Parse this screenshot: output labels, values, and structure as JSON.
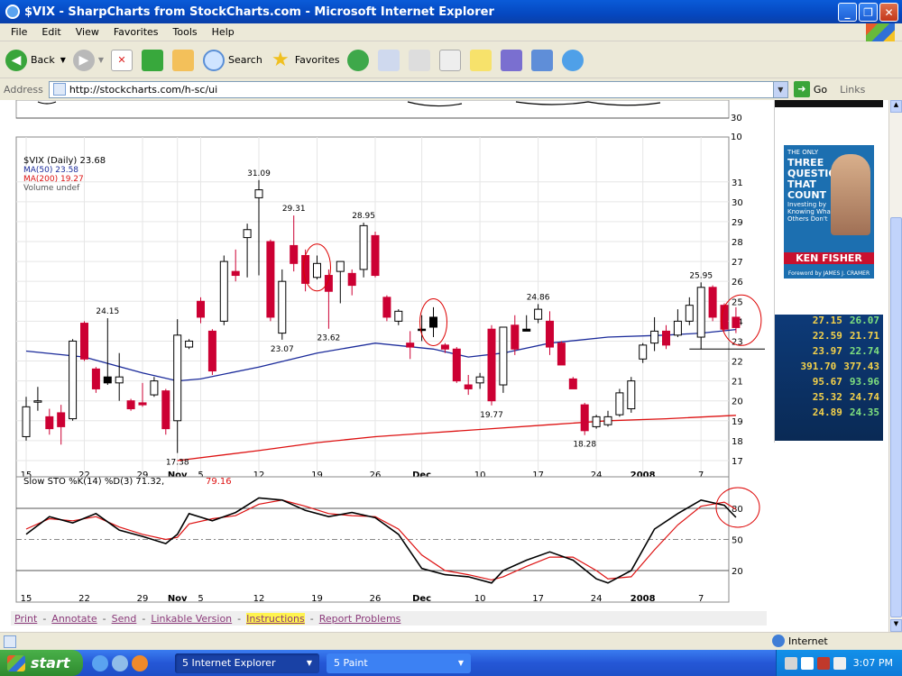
{
  "window": {
    "title": "$VIX - SharpCharts from StockCharts.com - Microsoft Internet Explorer",
    "btn_min": "_",
    "btn_max": "❐",
    "btn_close": "✕"
  },
  "menu": [
    "File",
    "Edit",
    "View",
    "Favorites",
    "Tools",
    "Help"
  ],
  "toolbar": {
    "back": "Back",
    "search": "Search",
    "favorites": "Favorites"
  },
  "address": {
    "label": "Address",
    "url": "http://stockcharts.com/h-sc/ui",
    "go": "Go",
    "links": "Links"
  },
  "ad": {
    "book_top": "THE ONLY",
    "book_title": "THREE QUESTIONS THAT COUNT",
    "book_sub": "Investing by Knowing What Others Don't",
    "author": "KEN FISHER",
    "foreword": "Foreword by JAMES J. CRAMER",
    "ticker_rows": [
      [
        "27.15",
        "26.07"
      ],
      [
        "22.59",
        "21.71"
      ],
      [
        "23.97",
        "22.74"
      ],
      [
        "391.70",
        "377.43"
      ],
      [
        "95.67",
        "93.96"
      ],
      [
        "25.32",
        "24.74"
      ],
      [
        "24.89",
        "24.35"
      ]
    ]
  },
  "chart_data": {
    "type": "candlestick",
    "legend": {
      "symbol": "$VIX (Daily) 23.68",
      "ma50": "MA(50) 23.58",
      "ma200": "MA(200) 19.27",
      "volume": "Volume undef"
    },
    "ylim": [
      16.5,
      32.8
    ],
    "y_ticks": [
      17,
      18,
      19,
      20,
      21,
      22,
      23,
      24,
      25,
      26,
      27,
      28,
      29,
      30,
      31
    ],
    "top_panel_ticks": [
      "30",
      "10"
    ],
    "x_ticks": [
      "15",
      "22",
      "29",
      "Nov",
      "5",
      "12",
      "19",
      "26",
      "Dec",
      "10",
      "17",
      "24",
      "2008",
      "7"
    ],
    "x_tick_days": [
      0,
      5,
      10,
      13,
      15,
      20,
      25,
      30,
      34,
      39,
      44,
      49,
      53,
      58
    ],
    "candles": [
      {
        "d": 0,
        "o": 18.2,
        "h": 20.2,
        "l": 18.0,
        "c": 19.7
      },
      {
        "d": 1,
        "o": 20.0,
        "h": 20.7,
        "l": 19.5,
        "c": 20.0
      },
      {
        "d": 2,
        "o": 19.2,
        "h": 19.6,
        "l": 18.3,
        "c": 18.6
      },
      {
        "d": 3,
        "o": 19.4,
        "h": 19.8,
        "l": 17.8,
        "c": 18.7
      },
      {
        "d": 4,
        "o": 19.1,
        "h": 23.1,
        "l": 19.0,
        "c": 23.0
      },
      {
        "d": 5,
        "o": 23.9,
        "h": 24.0,
        "l": 22.0,
        "c": 22.1
      },
      {
        "d": 6,
        "o": 21.6,
        "h": 21.7,
        "l": 20.4,
        "c": 20.6
      },
      {
        "d": 7,
        "o": 21.2,
        "h": 24.15,
        "l": 20.8,
        "c": 20.9
      },
      {
        "d": 8,
        "o": 20.9,
        "h": 22.4,
        "l": 20.0,
        "c": 21.2
      },
      {
        "d": 9,
        "o": 20.0,
        "h": 20.1,
        "l": 19.5,
        "c": 19.6
      },
      {
        "d": 10,
        "o": 19.9,
        "h": 20.9,
        "l": 19.7,
        "c": 19.8
      },
      {
        "d": 11,
        "o": 20.3,
        "h": 21.2,
        "l": 20.2,
        "c": 21.0
      },
      {
        "d": 12,
        "o": 20.5,
        "h": 20.6,
        "l": 18.3,
        "c": 18.6
      },
      {
        "d": 13,
        "o": 19.0,
        "h": 24.1,
        "l": 17.38,
        "c": 23.3
      },
      {
        "d": 14,
        "o": 23.0,
        "h": 23.1,
        "l": 22.6,
        "c": 22.7
      },
      {
        "d": 15,
        "o": 24.2,
        "h": 25.2,
        "l": 23.9,
        "c": 25.0
      },
      {
        "d": 16,
        "o": 23.5,
        "h": 23.6,
        "l": 21.3,
        "c": 21.5
      },
      {
        "d": 17,
        "o": 24.0,
        "h": 27.3,
        "l": 23.8,
        "c": 27.0
      },
      {
        "d": 18,
        "o": 26.5,
        "h": 27.6,
        "l": 26.0,
        "c": 26.3
      },
      {
        "d": 19,
        "o": 28.2,
        "h": 28.9,
        "l": 26.2,
        "c": 28.6
      },
      {
        "d": 20,
        "o": 30.2,
        "h": 31.09,
        "l": 26.3,
        "c": 30.6
      },
      {
        "d": 21,
        "o": 28.0,
        "h": 28.1,
        "l": 24.0,
        "c": 24.2
      },
      {
        "d": 22,
        "o": 23.4,
        "h": 26.6,
        "l": 23.07,
        "c": 26.0
      },
      {
        "d": 23,
        "o": 26.9,
        "h": 29.31,
        "l": 26.5,
        "c": 27.8
      },
      {
        "d": 24,
        "o": 27.3,
        "h": 27.6,
        "l": 25.5,
        "c": 25.9
      },
      {
        "d": 25,
        "o": 26.9,
        "h": 27.3,
        "l": 26.1,
        "c": 26.2
      },
      {
        "d": 26,
        "o": 26.3,
        "h": 26.6,
        "l": 23.62,
        "c": 25.5
      },
      {
        "d": 27,
        "o": 26.5,
        "h": 27.0,
        "l": 24.9,
        "c": 27.0
      },
      {
        "d": 28,
        "o": 26.4,
        "h": 26.6,
        "l": 25.3,
        "c": 25.8
      },
      {
        "d": 29,
        "o": 26.6,
        "h": 28.95,
        "l": 26.2,
        "c": 28.8
      },
      {
        "d": 30,
        "o": 28.3,
        "h": 28.5,
        "l": 26.2,
        "c": 26.3
      },
      {
        "d": 31,
        "o": 25.2,
        "h": 25.3,
        "l": 24.0,
        "c": 24.2
      },
      {
        "d": 32,
        "o": 24.5,
        "h": 24.6,
        "l": 23.8,
        "c": 24.0
      },
      {
        "d": 33,
        "o": 22.9,
        "h": 23.5,
        "l": 22.1,
        "c": 22.7
      },
      {
        "d": 34,
        "o": 23.6,
        "h": 24.3,
        "l": 23.0,
        "c": 23.6
      },
      {
        "d": 35,
        "o": 24.2,
        "h": 24.7,
        "l": 23.2,
        "c": 23.7
      },
      {
        "d": 36,
        "o": 22.8,
        "h": 22.9,
        "l": 22.4,
        "c": 22.6
      },
      {
        "d": 37,
        "o": 22.6,
        "h": 22.7,
        "l": 20.9,
        "c": 21.0
      },
      {
        "d": 38,
        "o": 20.8,
        "h": 21.3,
        "l": 20.3,
        "c": 20.6
      },
      {
        "d": 39,
        "o": 20.9,
        "h": 21.4,
        "l": 20.6,
        "c": 21.2
      },
      {
        "d": 40,
        "o": 23.6,
        "h": 23.8,
        "l": 19.77,
        "c": 20.0
      },
      {
        "d": 41,
        "o": 20.8,
        "h": 22.9,
        "l": 20.4,
        "c": 23.7
      },
      {
        "d": 42,
        "o": 23.8,
        "h": 24.3,
        "l": 22.3,
        "c": 22.6
      },
      {
        "d": 43,
        "o": 23.6,
        "h": 24.3,
        "l": 23.5,
        "c": 23.5
      },
      {
        "d": 44,
        "o": 24.1,
        "h": 24.86,
        "l": 23.9,
        "c": 24.6
      },
      {
        "d": 45,
        "o": 24.0,
        "h": 24.5,
        "l": 22.3,
        "c": 22.7
      },
      {
        "d": 46,
        "o": 22.9,
        "h": 23.0,
        "l": 21.9,
        "c": 21.8
      },
      {
        "d": 47,
        "o": 21.1,
        "h": 21.2,
        "l": 20.6,
        "c": 20.6
      },
      {
        "d": 48,
        "o": 19.8,
        "h": 19.9,
        "l": 18.28,
        "c": 18.5
      },
      {
        "d": 49,
        "o": 18.7,
        "h": 19.3,
        "l": 18.6,
        "c": 19.2
      },
      {
        "d": 50,
        "o": 18.8,
        "h": 19.5,
        "l": 18.7,
        "c": 19.2
      },
      {
        "d": 51,
        "o": 19.3,
        "h": 20.6,
        "l": 19.2,
        "c": 20.4
      },
      {
        "d": 52,
        "o": 19.6,
        "h": 21.2,
        "l": 19.4,
        "c": 21.0
      },
      {
        "d": 53,
        "o": 22.1,
        "h": 22.9,
        "l": 21.9,
        "c": 22.8
      },
      {
        "d": 54,
        "o": 22.9,
        "h": 24.2,
        "l": 22.5,
        "c": 23.5
      },
      {
        "d": 55,
        "o": 23.5,
        "h": 23.8,
        "l": 22.6,
        "c": 22.8
      },
      {
        "d": 56,
        "o": 23.3,
        "h": 24.6,
        "l": 23.2,
        "c": 24.0
      },
      {
        "d": 57,
        "o": 24.0,
        "h": 25.2,
        "l": 23.8,
        "c": 24.8
      },
      {
        "d": 58,
        "o": 23.2,
        "h": 25.95,
        "l": 22.6,
        "c": 25.7
      },
      {
        "d": 59,
        "o": 25.7,
        "h": 25.8,
        "l": 24.0,
        "c": 24.2
      },
      {
        "d": 60,
        "o": 24.8,
        "h": 24.9,
        "l": 23.5,
        "c": 23.6
      },
      {
        "d": 61,
        "o": 24.2,
        "h": 24.7,
        "l": 23.4,
        "c": 23.68
      }
    ],
    "bullish": [
      0,
      1,
      4,
      8,
      11,
      13,
      14,
      17,
      19,
      20,
      22,
      25,
      27,
      29,
      32,
      39,
      41,
      44,
      49,
      50,
      51,
      52,
      53,
      54,
      56,
      57,
      58
    ],
    "filled_up": [
      7,
      34,
      35,
      43
    ],
    "value_labels": [
      {
        "d": 7,
        "text": "24.15",
        "v": 24.15,
        "pos": "above"
      },
      {
        "d": 13,
        "text": "17.38",
        "v": 17.38,
        "pos": "below"
      },
      {
        "d": 20,
        "text": "31.09",
        "v": 31.09,
        "pos": "above"
      },
      {
        "d": 22,
        "text": "23.07",
        "v": 23.07,
        "pos": "below"
      },
      {
        "d": 23,
        "text": "29.31",
        "v": 29.31,
        "pos": "above"
      },
      {
        "d": 26,
        "text": "23.62",
        "v": 23.62,
        "pos": "below"
      },
      {
        "d": 29,
        "text": "28.95",
        "v": 28.95,
        "pos": "above"
      },
      {
        "d": 40,
        "text": "19.77",
        "v": 19.77,
        "pos": "below"
      },
      {
        "d": 44,
        "text": "24.86",
        "v": 24.86,
        "pos": "above"
      },
      {
        "d": 48,
        "text": "18.28",
        "v": 18.28,
        "pos": "below"
      },
      {
        "d": 58,
        "text": "25.95",
        "v": 25.95,
        "pos": "above"
      }
    ],
    "ma50": [
      [
        0,
        22.5
      ],
      [
        5,
        22.2
      ],
      [
        10,
        21.4
      ],
      [
        13,
        21.0
      ],
      [
        15,
        21.1
      ],
      [
        20,
        21.7
      ],
      [
        25,
        22.4
      ],
      [
        30,
        22.9
      ],
      [
        35,
        22.6
      ],
      [
        38,
        22.2
      ],
      [
        41,
        22.4
      ],
      [
        45,
        22.9
      ],
      [
        50,
        23.2
      ],
      [
        55,
        23.3
      ],
      [
        58,
        23.4
      ],
      [
        61,
        23.58
      ]
    ],
    "ma200": [
      [
        13,
        17.0
      ],
      [
        20,
        17.5
      ],
      [
        25,
        17.9
      ],
      [
        30,
        18.2
      ],
      [
        35,
        18.4
      ],
      [
        40,
        18.6
      ],
      [
        45,
        18.8
      ],
      [
        50,
        19.0
      ],
      [
        55,
        19.1
      ],
      [
        61,
        19.27
      ]
    ],
    "annotation_circles_days": [
      25,
      35,
      61
    ],
    "ref_line_value": 22.6,
    "stoch": {
      "label": "Slow STO %K(14) %D(3) 71.32,",
      "d_label": "79.16",
      "ylim": [
        0,
        100
      ],
      "y_ticks": [
        20,
        50,
        80
      ],
      "k": [
        [
          0,
          55
        ],
        [
          2,
          72
        ],
        [
          4,
          66
        ],
        [
          6,
          75
        ],
        [
          8,
          59
        ],
        [
          10,
          53
        ],
        [
          12,
          46
        ],
        [
          13,
          55
        ],
        [
          14,
          75
        ],
        [
          16,
          68
        ],
        [
          18,
          76
        ],
        [
          20,
          90
        ],
        [
          22,
          88
        ],
        [
          24,
          78
        ],
        [
          26,
          72
        ],
        [
          28,
          76
        ],
        [
          30,
          71
        ],
        [
          32,
          55
        ],
        [
          34,
          22
        ],
        [
          36,
          16
        ],
        [
          38,
          14
        ],
        [
          40,
          8
        ],
        [
          41,
          20
        ],
        [
          43,
          30
        ],
        [
          45,
          38
        ],
        [
          47,
          30
        ],
        [
          49,
          12
        ],
        [
          50,
          8
        ],
        [
          52,
          20
        ],
        [
          54,
          60
        ],
        [
          56,
          75
        ],
        [
          58,
          88
        ],
        [
          60,
          83
        ],
        [
          61,
          71.32
        ]
      ],
      "d": [
        [
          0,
          60
        ],
        [
          2,
          70
        ],
        [
          4,
          68
        ],
        [
          6,
          72
        ],
        [
          8,
          62
        ],
        [
          10,
          55
        ],
        [
          12,
          50
        ],
        [
          13,
          52
        ],
        [
          14,
          65
        ],
        [
          16,
          70
        ],
        [
          18,
          73
        ],
        [
          20,
          84
        ],
        [
          22,
          88
        ],
        [
          24,
          82
        ],
        [
          26,
          75
        ],
        [
          28,
          73
        ],
        [
          30,
          72
        ],
        [
          32,
          60
        ],
        [
          34,
          35
        ],
        [
          36,
          20
        ],
        [
          38,
          16
        ],
        [
          40,
          11
        ],
        [
          41,
          14
        ],
        [
          43,
          24
        ],
        [
          45,
          33
        ],
        [
          47,
          33
        ],
        [
          49,
          20
        ],
        [
          50,
          12
        ],
        [
          52,
          14
        ],
        [
          54,
          40
        ],
        [
          56,
          64
        ],
        [
          58,
          82
        ],
        [
          60,
          86
        ],
        [
          61,
          79.16
        ]
      ]
    }
  },
  "footer_links": [
    "Print",
    "Annotate",
    "Send",
    "Linkable Version",
    "Instructions",
    "Report Problems"
  ],
  "status": {
    "zone": "Internet"
  },
  "taskbar": {
    "start": "start",
    "task1": "5 Internet Explorer",
    "task2": "5 Paint",
    "clock": "3:07 PM"
  },
  "colors": {
    "up_down_red": "#cc0033",
    "ma50": "#1a2a9a",
    "ma200": "#dd1111",
    "circle": "#dd0000"
  }
}
